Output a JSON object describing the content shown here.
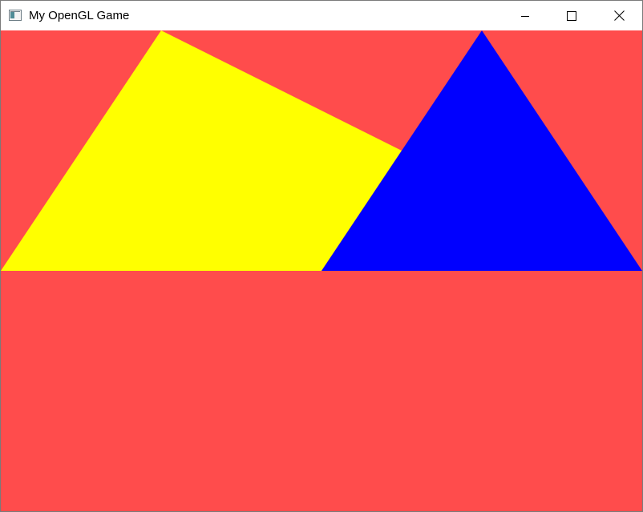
{
  "window": {
    "title": "My OpenGL Game",
    "app_icon": "application-window-icon",
    "controls": {
      "minimize_icon": "minimize-icon",
      "maximize_icon": "maximize-icon",
      "close_icon": "close-icon"
    }
  },
  "scene": {
    "clear_color": "#ff4c4c",
    "shapes": [
      {
        "name": "yellow-quad",
        "color": "#ffff00"
      },
      {
        "name": "blue-triangle",
        "color": "#0000ff"
      }
    ]
  }
}
